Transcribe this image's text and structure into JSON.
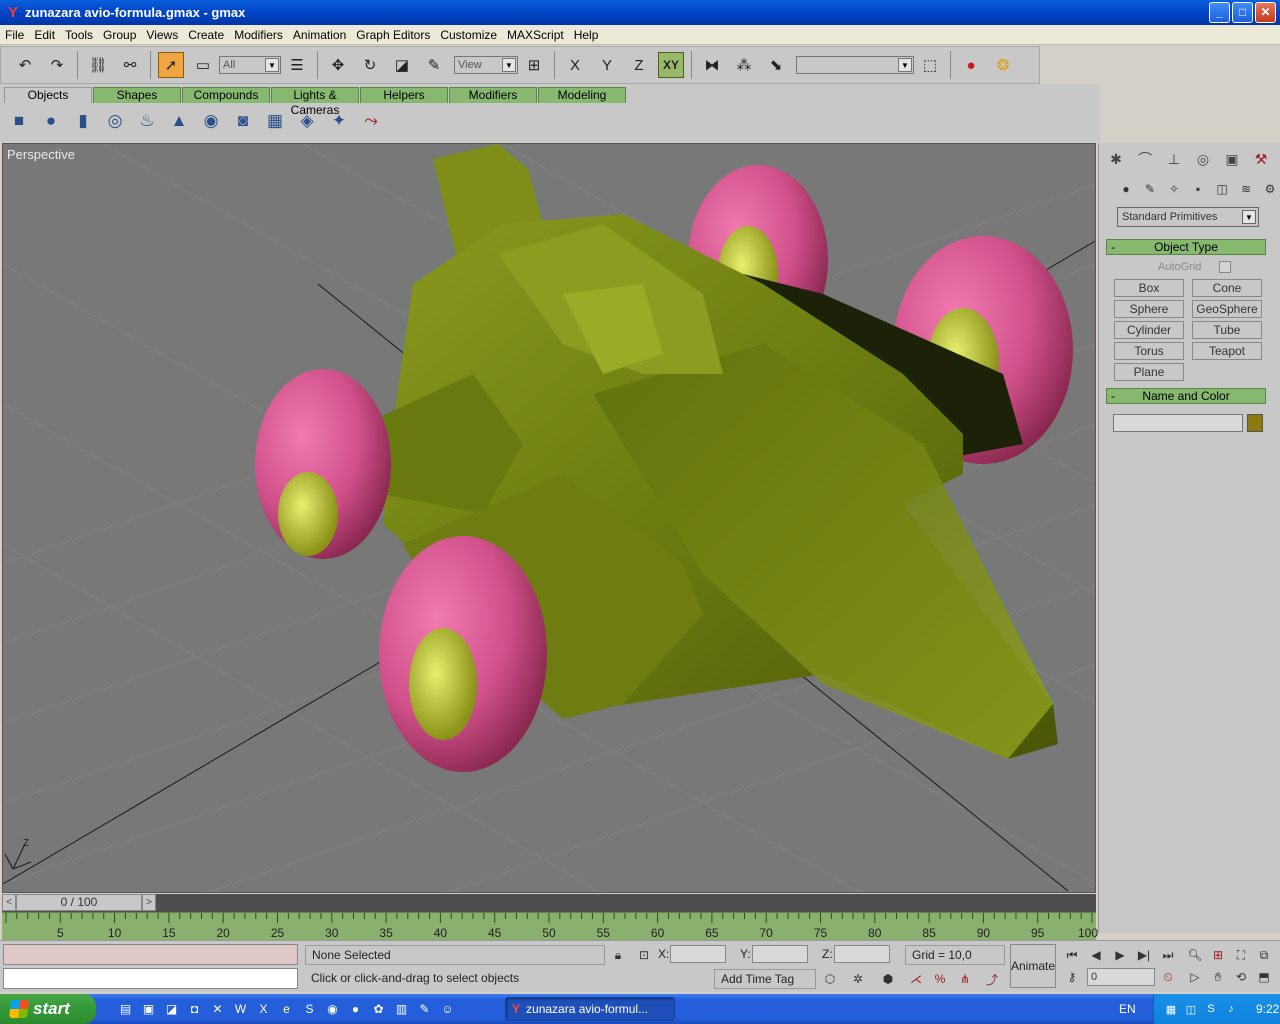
{
  "window": {
    "title": "zunazara avio-formula.gmax - gmax",
    "app_icon": "gmax-icon",
    "controls": [
      "minimize",
      "maximize",
      "close"
    ]
  },
  "menu": {
    "items": [
      "File",
      "Edit",
      "Tools",
      "Group",
      "Views",
      "Create",
      "Modifiers",
      "Animation",
      "Graph Editors",
      "Customize",
      "MAXScript",
      "Help"
    ]
  },
  "toolbar": {
    "selection_filter": "All",
    "ref_coord": "View",
    "axis_x": "X",
    "axis_y": "Y",
    "axis_z": "Z",
    "axis_xy": "XY",
    "named_selection": ""
  },
  "tabs": {
    "items": [
      "Objects",
      "Shapes",
      "Compounds",
      "Lights & Cameras",
      "Helpers",
      "Modifiers",
      "Modeling"
    ],
    "active": "Objects"
  },
  "viewport": {
    "label": "Perspective",
    "axis_label": "Z",
    "colors": {
      "background": "#787878",
      "grid": "#8a8a8a",
      "body": "#6b7a10",
      "tire": "#d0508a",
      "rim": "#c8d23a"
    }
  },
  "command_panel": {
    "dropdown": "Standard Primitives",
    "object_type": {
      "title": "Object Type",
      "collapse": "-",
      "autogrid": "AutoGrid",
      "buttons": [
        "Box",
        "Cone",
        "Sphere",
        "GeoSphere",
        "Cylinder",
        "Tube",
        "Torus",
        "Teapot",
        "Plane"
      ]
    },
    "name_color": {
      "title": "Name and Color",
      "collapse": "-",
      "name_value": "",
      "color": "#8a7a10"
    }
  },
  "timeline": {
    "frame_display": "0 / 100",
    "left_arrow": "<",
    "right_arrow": ">",
    "ticks": [
      "5",
      "10",
      "15",
      "20",
      "25",
      "30",
      "35",
      "40",
      "45",
      "50",
      "55",
      "60",
      "65",
      "70",
      "75",
      "80",
      "85",
      "90",
      "95",
      "100"
    ]
  },
  "status": {
    "selection": "None Selected",
    "prompt": "Click or click-and-drag to select objects",
    "x_label": "X:",
    "y_label": "Y:",
    "z_label": "Z:",
    "x_value": "",
    "y_value": "",
    "z_value": "",
    "grid": "Grid = 10,0",
    "add_time_tag": "Add Time Tag",
    "animate": "Animate",
    "current_frame": "0"
  },
  "taskbar": {
    "start": "start",
    "task": "zunazara avio-formul...",
    "language": "EN",
    "clock": "9:22"
  }
}
